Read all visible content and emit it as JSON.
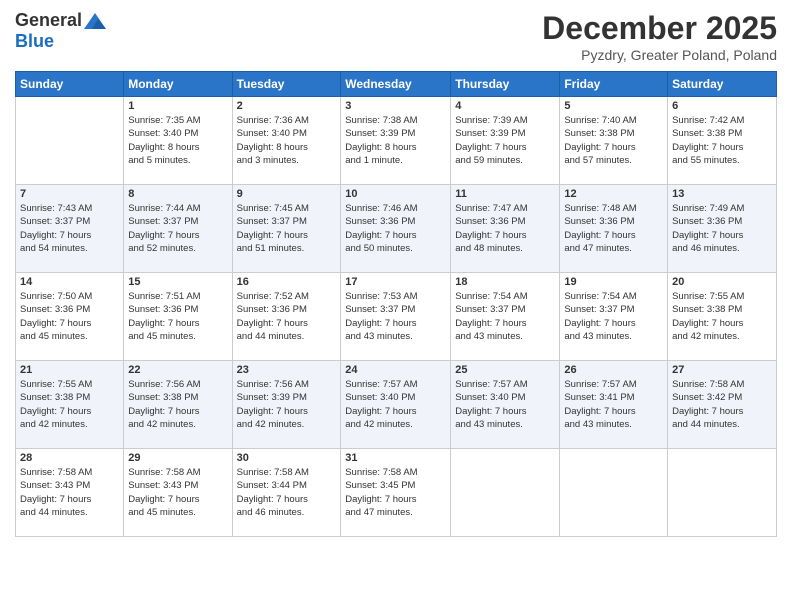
{
  "logo": {
    "general": "General",
    "blue": "Blue"
  },
  "title": "December 2025",
  "location": "Pyzdry, Greater Poland, Poland",
  "days_of_week": [
    "Sunday",
    "Monday",
    "Tuesday",
    "Wednesday",
    "Thursday",
    "Friday",
    "Saturday"
  ],
  "weeks": [
    [
      {
        "day": "",
        "info": ""
      },
      {
        "day": "1",
        "info": "Sunrise: 7:35 AM\nSunset: 3:40 PM\nDaylight: 8 hours\nand 5 minutes."
      },
      {
        "day": "2",
        "info": "Sunrise: 7:36 AM\nSunset: 3:40 PM\nDaylight: 8 hours\nand 3 minutes."
      },
      {
        "day": "3",
        "info": "Sunrise: 7:38 AM\nSunset: 3:39 PM\nDaylight: 8 hours\nand 1 minute."
      },
      {
        "day": "4",
        "info": "Sunrise: 7:39 AM\nSunset: 3:39 PM\nDaylight: 7 hours\nand 59 minutes."
      },
      {
        "day": "5",
        "info": "Sunrise: 7:40 AM\nSunset: 3:38 PM\nDaylight: 7 hours\nand 57 minutes."
      },
      {
        "day": "6",
        "info": "Sunrise: 7:42 AM\nSunset: 3:38 PM\nDaylight: 7 hours\nand 55 minutes."
      }
    ],
    [
      {
        "day": "7",
        "info": "Sunrise: 7:43 AM\nSunset: 3:37 PM\nDaylight: 7 hours\nand 54 minutes."
      },
      {
        "day": "8",
        "info": "Sunrise: 7:44 AM\nSunset: 3:37 PM\nDaylight: 7 hours\nand 52 minutes."
      },
      {
        "day": "9",
        "info": "Sunrise: 7:45 AM\nSunset: 3:37 PM\nDaylight: 7 hours\nand 51 minutes."
      },
      {
        "day": "10",
        "info": "Sunrise: 7:46 AM\nSunset: 3:36 PM\nDaylight: 7 hours\nand 50 minutes."
      },
      {
        "day": "11",
        "info": "Sunrise: 7:47 AM\nSunset: 3:36 PM\nDaylight: 7 hours\nand 48 minutes."
      },
      {
        "day": "12",
        "info": "Sunrise: 7:48 AM\nSunset: 3:36 PM\nDaylight: 7 hours\nand 47 minutes."
      },
      {
        "day": "13",
        "info": "Sunrise: 7:49 AM\nSunset: 3:36 PM\nDaylight: 7 hours\nand 46 minutes."
      }
    ],
    [
      {
        "day": "14",
        "info": "Sunrise: 7:50 AM\nSunset: 3:36 PM\nDaylight: 7 hours\nand 45 minutes."
      },
      {
        "day": "15",
        "info": "Sunrise: 7:51 AM\nSunset: 3:36 PM\nDaylight: 7 hours\nand 45 minutes."
      },
      {
        "day": "16",
        "info": "Sunrise: 7:52 AM\nSunset: 3:36 PM\nDaylight: 7 hours\nand 44 minutes."
      },
      {
        "day": "17",
        "info": "Sunrise: 7:53 AM\nSunset: 3:37 PM\nDaylight: 7 hours\nand 43 minutes."
      },
      {
        "day": "18",
        "info": "Sunrise: 7:54 AM\nSunset: 3:37 PM\nDaylight: 7 hours\nand 43 minutes."
      },
      {
        "day": "19",
        "info": "Sunrise: 7:54 AM\nSunset: 3:37 PM\nDaylight: 7 hours\nand 43 minutes."
      },
      {
        "day": "20",
        "info": "Sunrise: 7:55 AM\nSunset: 3:38 PM\nDaylight: 7 hours\nand 42 minutes."
      }
    ],
    [
      {
        "day": "21",
        "info": "Sunrise: 7:55 AM\nSunset: 3:38 PM\nDaylight: 7 hours\nand 42 minutes."
      },
      {
        "day": "22",
        "info": "Sunrise: 7:56 AM\nSunset: 3:38 PM\nDaylight: 7 hours\nand 42 minutes."
      },
      {
        "day": "23",
        "info": "Sunrise: 7:56 AM\nSunset: 3:39 PM\nDaylight: 7 hours\nand 42 minutes."
      },
      {
        "day": "24",
        "info": "Sunrise: 7:57 AM\nSunset: 3:40 PM\nDaylight: 7 hours\nand 42 minutes."
      },
      {
        "day": "25",
        "info": "Sunrise: 7:57 AM\nSunset: 3:40 PM\nDaylight: 7 hours\nand 43 minutes."
      },
      {
        "day": "26",
        "info": "Sunrise: 7:57 AM\nSunset: 3:41 PM\nDaylight: 7 hours\nand 43 minutes."
      },
      {
        "day": "27",
        "info": "Sunrise: 7:58 AM\nSunset: 3:42 PM\nDaylight: 7 hours\nand 44 minutes."
      }
    ],
    [
      {
        "day": "28",
        "info": "Sunrise: 7:58 AM\nSunset: 3:43 PM\nDaylight: 7 hours\nand 44 minutes."
      },
      {
        "day": "29",
        "info": "Sunrise: 7:58 AM\nSunset: 3:43 PM\nDaylight: 7 hours\nand 45 minutes."
      },
      {
        "day": "30",
        "info": "Sunrise: 7:58 AM\nSunset: 3:44 PM\nDaylight: 7 hours\nand 46 minutes."
      },
      {
        "day": "31",
        "info": "Sunrise: 7:58 AM\nSunset: 3:45 PM\nDaylight: 7 hours\nand 47 minutes."
      },
      {
        "day": "",
        "info": ""
      },
      {
        "day": "",
        "info": ""
      },
      {
        "day": "",
        "info": ""
      }
    ]
  ]
}
